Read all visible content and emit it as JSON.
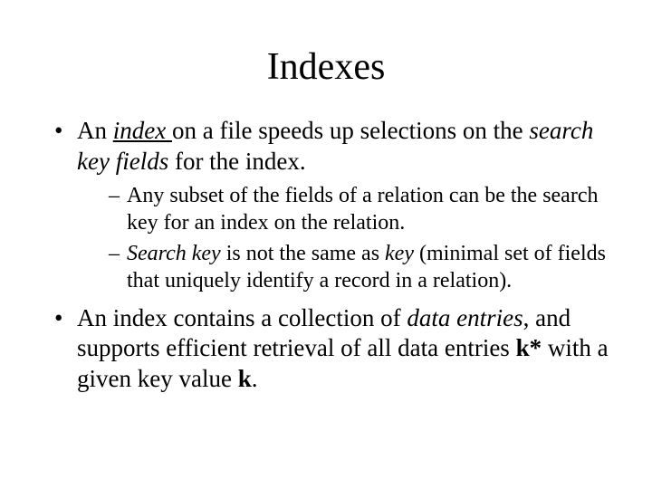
{
  "title": "Indexes",
  "bullet1": {
    "prefix": "An ",
    "index_word": "index ",
    "mid1": "on a file speeds up selections on the ",
    "search_key_fields": "search key fields",
    "suffix": " for the index."
  },
  "sub1": "Any subset of the fields of a relation can be the search key for an index on the relation.",
  "sub2": {
    "search_key": "Search key",
    "mid1": " is ",
    "not_word": "not",
    "mid2": " the same as ",
    "key_word": "key",
    "suffix": " (minimal set of fields that uniquely identify a record in a relation)."
  },
  "bullet2": {
    "prefix": "An index contains a collection of ",
    "data_entries": "data entries",
    "mid1": ", and supports efficient retrieval of all data entries ",
    "k_star": "k*",
    "mid2": " with a given key value ",
    "k_bold": "k",
    "suffix": "."
  }
}
